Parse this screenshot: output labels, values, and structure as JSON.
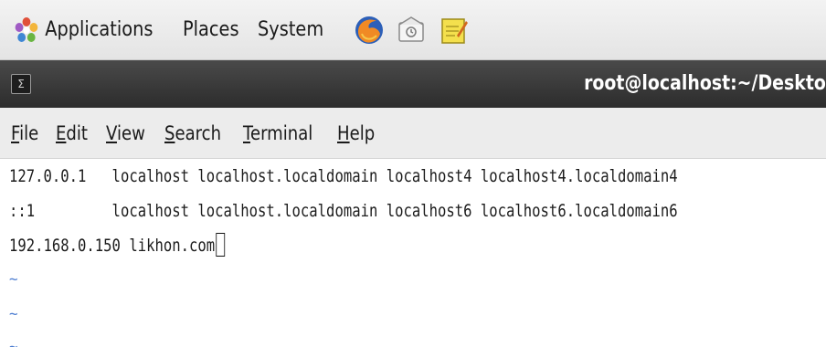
{
  "panel": {
    "menus": [
      "Applications",
      "Places",
      "System"
    ],
    "launchers": [
      "firefox-icon",
      "mail-icon",
      "notes-icon"
    ]
  },
  "window": {
    "title": "root@localhost:~/Deskto"
  },
  "menubar": {
    "items": [
      {
        "label": "File",
        "mnemonic": "F",
        "rest": "ile"
      },
      {
        "label": "Edit",
        "mnemonic": "E",
        "rest": "dit"
      },
      {
        "label": "View",
        "mnemonic": "V",
        "rest": "iew"
      },
      {
        "label": "Search",
        "mnemonic": "S",
        "rest": "earch"
      },
      {
        "label": "Terminal",
        "mnemonic": "T",
        "rest": "erminal"
      },
      {
        "label": "Help",
        "mnemonic": "H",
        "rest": "elp"
      }
    ]
  },
  "terminal": {
    "lines": [
      "127.0.0.1   localhost localhost.localdomain localhost4 localhost4.localdomain4",
      "::1         localhost localhost.localdomain localhost6 localhost6.localdomain6",
      "192.168.0.150 likhon.com"
    ],
    "tilde": "~"
  },
  "colors": {
    "titlebar": "#2c2c2c",
    "tilde": "#4a7bd0"
  }
}
